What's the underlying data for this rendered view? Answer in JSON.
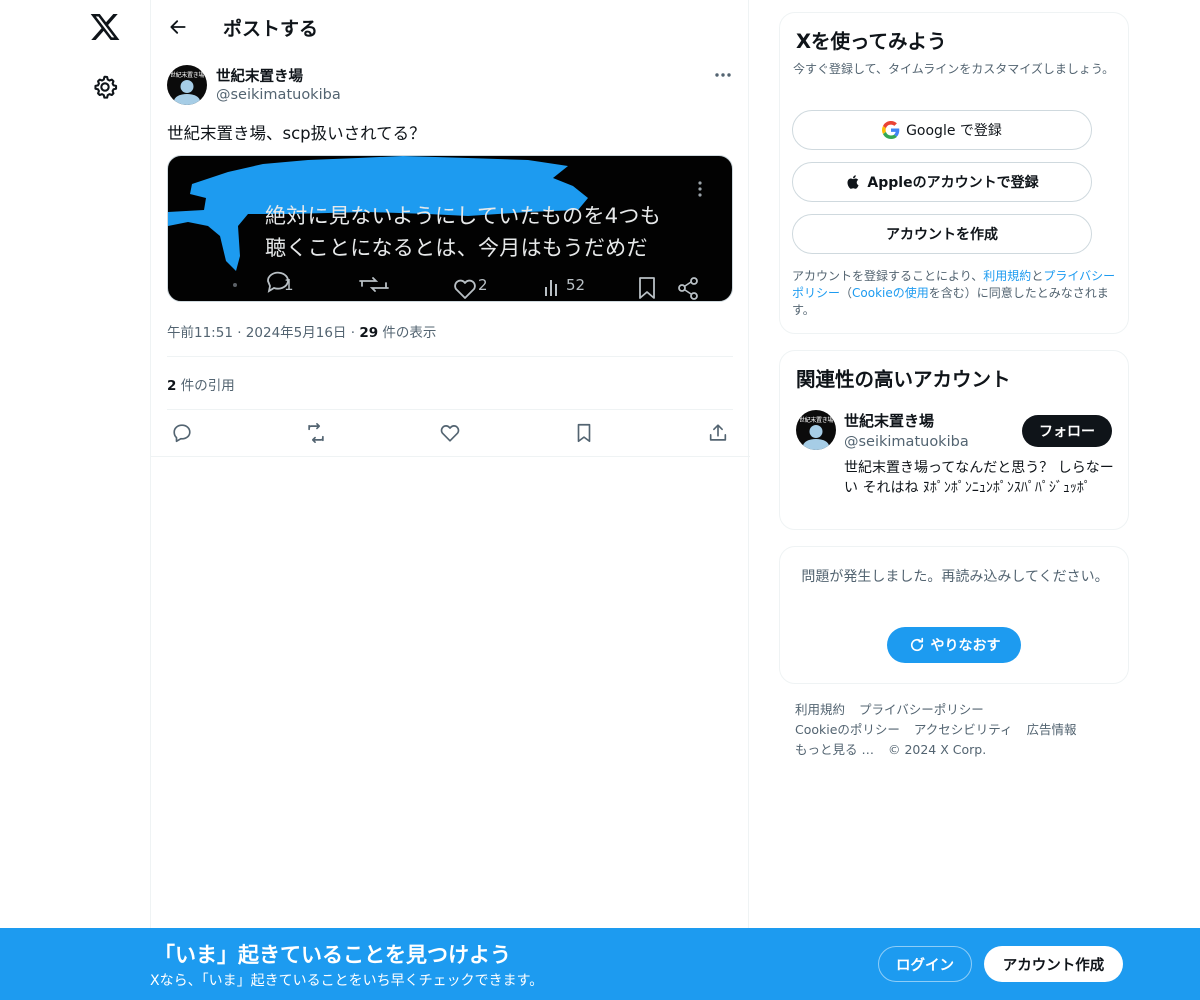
{
  "header": {
    "title": "ポストする"
  },
  "post": {
    "author_name": "世紀末置き場",
    "author_handle": "@seikimatuokiba",
    "avatar_label": "世紀末置き場",
    "text": "世紀末置き場、scp扱いされてる？",
    "media": {
      "line1": "絶対に見ないようにしていたものを4つも",
      "line2": "聴くことになるとは、今月はもうだめだ",
      "replies": "1",
      "likes": "2",
      "views": "52"
    },
    "meta": {
      "time": "午前11:51",
      "date": "2024年5月16日",
      "views_count": "29",
      "views_label": " 件の表示"
    },
    "quotes": {
      "count": "2",
      "label": " 件の引用"
    }
  },
  "signup_card": {
    "title": "Xを使ってみよう",
    "description": "今すぐ登録して、タイムラインをカスタマイズしましょう。",
    "google_button": "Google で登録",
    "apple_button": "Appleのアカウントで登録",
    "create_button": "アカウントを作成",
    "terms": {
      "part1": "アカウントを登録することにより、",
      "link1": "利用規約",
      "part2": "と",
      "link2": "プライバシーポリシー",
      "part3": "（",
      "link3": "Cookieの使用",
      "part4": "を含む）に同意したとみなされます。"
    }
  },
  "related_card": {
    "title": "関連性の高いアカウント",
    "account_name": "世紀末置き場",
    "account_handle": "@seikimatuokiba",
    "avatar_label": "世紀末置き場",
    "follow_button": "フォロー",
    "bio": "世紀末置き場ってなんだと思う？ しらなーい それはね ﾇﾎﾟﾝﾎﾟﾝﾆｭﾝﾎﾟﾝｽﾊﾟﾊﾟｼﾞｭｯﾎﾟ"
  },
  "error_card": {
    "message": "問題が発生しました。再読み込みしてください。",
    "retry_button": "やりなおす"
  },
  "footer": {
    "terms": "利用規約",
    "privacy": "プライバシーポリシー",
    "cookie": "Cookieのポリシー",
    "accessibility": "アクセシビリティ",
    "ads": "広告情報",
    "more": "もっと見る …",
    "copyright": "© 2024 X Corp."
  },
  "bottom_bar": {
    "title": "「いま」起きていることを見つけよう",
    "subtitle": "Xなら、「いま」起きていることをいち早くチェックできます。",
    "login_button": "ログイン",
    "signup_button": "アカウント作成"
  },
  "colors": {
    "accent": "#1d9bf0",
    "text_primary": "#0f1419",
    "text_secondary": "#536471",
    "border": "#eff3f4"
  },
  "icons": [
    "x-logo-icon",
    "gear-icon",
    "back-arrow-icon",
    "more-icon",
    "reply-icon",
    "repost-icon",
    "like-icon",
    "bookmark-icon",
    "share-icon",
    "google-icon",
    "apple-icon",
    "refresh-icon"
  ]
}
